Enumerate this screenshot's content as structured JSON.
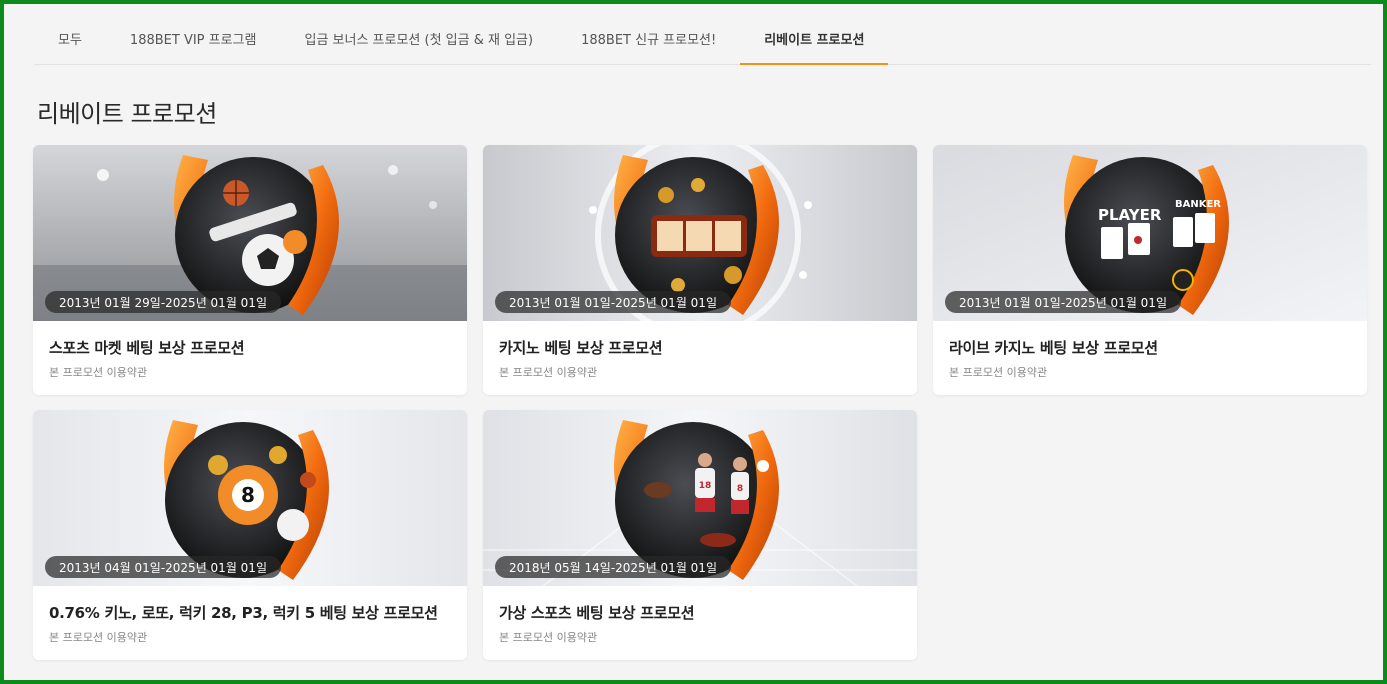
{
  "tabs": [
    {
      "label": "모두"
    },
    {
      "label": "188BET VIP 프로그램"
    },
    {
      "label": "입금 보너스 프로모션 (첫 입금 & 재 입금)"
    },
    {
      "label": "188BET 신규 프로모션!"
    },
    {
      "label": "리베이트 프로모션",
      "active": true
    }
  ],
  "page_title": "리베이트 프로모션",
  "colors": {
    "accent": "#f29112",
    "frame": "#0c8a1c"
  },
  "cards": [
    {
      "date": "2013년 01월 29일-2025년 01월 01일",
      "title": "스포츠 마켓 베팅 보상 프로모션",
      "terms": "본 프로모션 이용약관",
      "theme": "sports-icon"
    },
    {
      "date": "2013년 01월 01일-2025년 01월 01일",
      "title": "카지노 베팅 보상 프로모션",
      "terms": "본 프로모션 이용약관",
      "theme": "slot-machine-icon"
    },
    {
      "date": "2013년 01월 01일-2025년 01월 01일",
      "title": "라이브 카지노 베팅 보상 프로모션",
      "terms": "본 프로모션 이용약관",
      "theme": "playing-cards-icon",
      "banner_text": [
        "PLAYER",
        "BANKER"
      ]
    },
    {
      "date": "2013년 04월 01일-2025년 01월 01일",
      "title": "0.76% 키노, 로또, 럭키 28, P3, 럭키 5 베팅 보상 프로모션",
      "terms": "본 프로모션 이용약관",
      "theme": "lottery-ball-icon",
      "banner_text": [
        "8"
      ]
    },
    {
      "date": "2018년 05월 14일-2025년 01월 01일",
      "title": "가상 스포츠 베팅 보상 프로모션",
      "terms": "본 프로모션 이용약관",
      "theme": "virtual-sports-icon",
      "banner_text": [
        "18",
        "8"
      ]
    }
  ]
}
